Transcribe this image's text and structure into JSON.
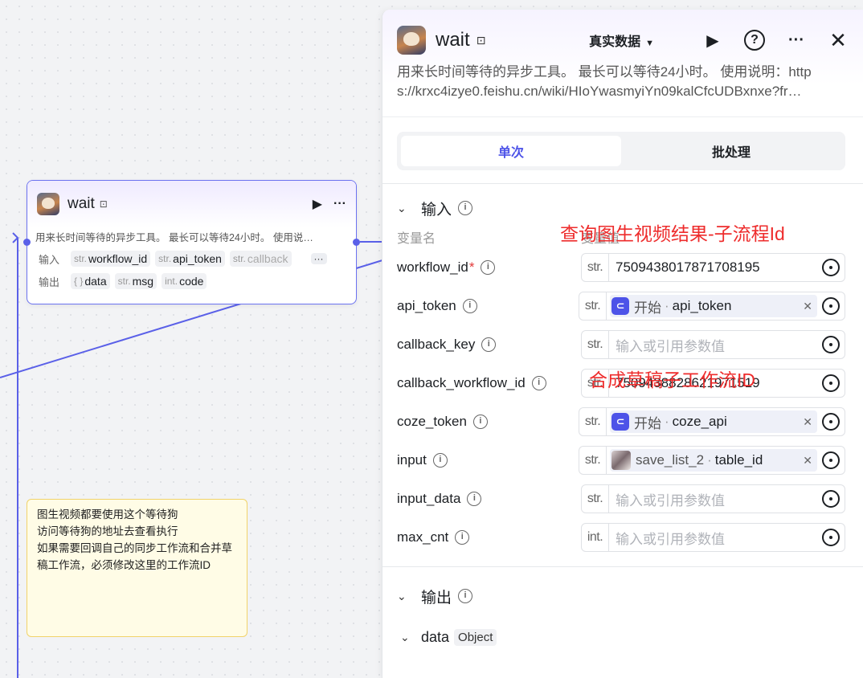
{
  "node": {
    "title": "wait",
    "description": "用来长时间等待的异步工具。 最长可以等待24小时。 使用说…",
    "input_label": "输入",
    "output_label": "输出",
    "inputs": [
      {
        "type": "str.",
        "name": "workflow_id"
      },
      {
        "type": "str.",
        "name": "api_token"
      },
      {
        "type": "str.",
        "name": "callback"
      }
    ],
    "more": "···",
    "outputs": [
      {
        "type": "{ }",
        "name": "data"
      },
      {
        "type": "str.",
        "name": "msg"
      },
      {
        "type": "int.",
        "name": "code"
      }
    ]
  },
  "note": {
    "lines": [
      "图生视频都要使用这个等待狗",
      "访问等待狗的地址去查看执行",
      "如果需要回调自己的同步工作流和合并草",
      "稿工作流，必须修改这里的工作流ID"
    ]
  },
  "panel": {
    "title": "wait",
    "data_mode": "真实数据",
    "description_line1": "用来长时间等待的异步工具。 最长可以等待24小时。 使用说明：http",
    "description_line2": "s://krxc4izye0.feishu.cn/wiki/HIoYwasmyiYn09kalCfcUDBxnxe?fr…",
    "tabs": {
      "single": "单次",
      "batch": "批处理"
    },
    "input_section": "输入",
    "col_name": "变量名",
    "col_value": "变量值",
    "variables": [
      {
        "name": "workflow_id",
        "required": "*",
        "type": "str.",
        "value": "7509438017871708195"
      },
      {
        "name": "api_token",
        "type": "str.",
        "ref_source": "开始",
        "ref_field": "api_token"
      },
      {
        "name": "callback_key",
        "type": "str.",
        "placeholder": "输入或引用参数值"
      },
      {
        "name": "callback_workflow_id",
        "type": "str.",
        "value": "7509438828621971519"
      },
      {
        "name": "coze_token",
        "type": "str.",
        "ref_source": "开始",
        "ref_field": "coze_api"
      },
      {
        "name": "input",
        "type": "str.",
        "ref_source": "save_list_2",
        "ref_field": "table_id"
      },
      {
        "name": "input_data",
        "type": "str.",
        "placeholder": "输入或引用参数值"
      },
      {
        "name": "max_cnt",
        "type": "int.",
        "placeholder": "输入或引用参数值"
      }
    ],
    "output_section": "输出",
    "output_item": {
      "name": "data",
      "type": "Object"
    }
  },
  "annotations": {
    "workflow_note": "查询图生视频结果-子流程Id",
    "callback_note": "合成草稿子工作流ID"
  },
  "colors": {
    "accent": "#4d53e8",
    "annotation": "#ee2c2c",
    "note_bg": "#fffce6"
  },
  "icons": {
    "run": "play-icon",
    "more": "ellipsis-icon",
    "close": "close-icon",
    "help": "question-icon",
    "info": "info-icon",
    "reference": "target-icon"
  }
}
